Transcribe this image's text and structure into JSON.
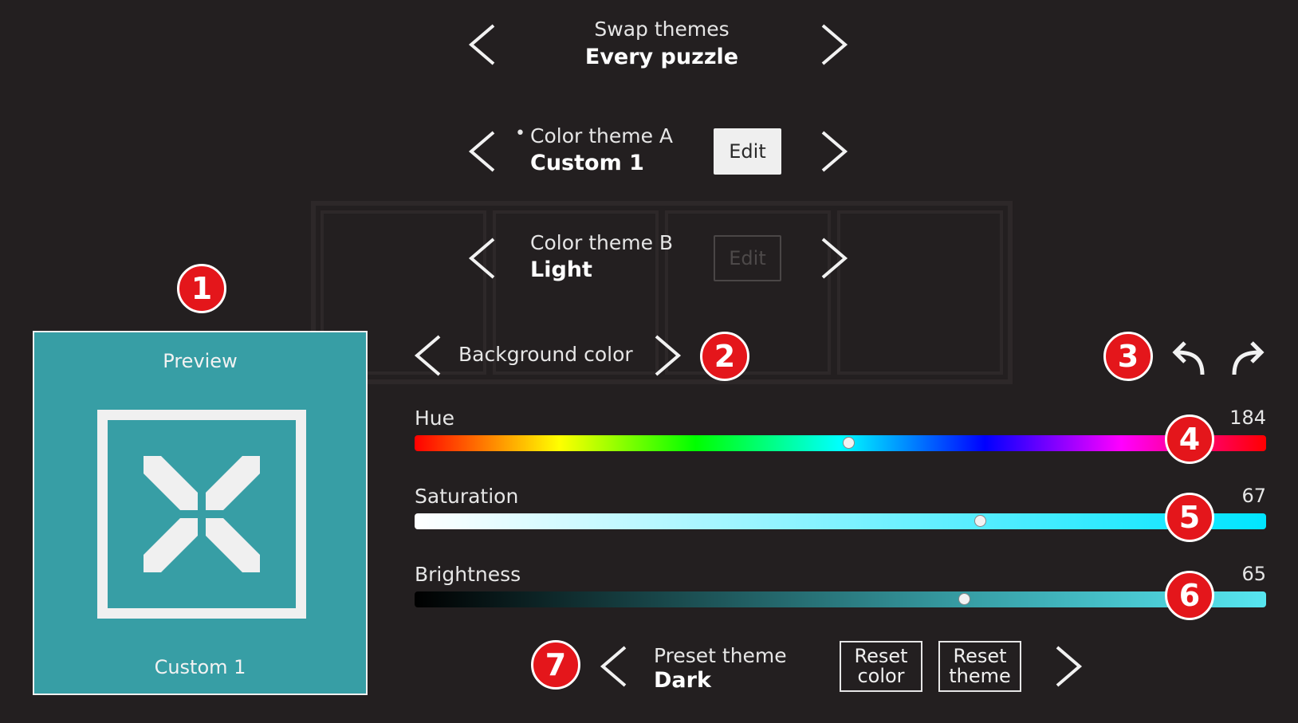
{
  "swap": {
    "label": "Swap themes",
    "value": "Every puzzle"
  },
  "theme_a": {
    "bullet": "•",
    "label": "Color theme A",
    "value": "Custom 1",
    "edit_label": "Edit"
  },
  "theme_b": {
    "label": "Color theme B",
    "value": "Light",
    "edit_label": "Edit"
  },
  "preview": {
    "title": "Preview",
    "theme_name": "Custom 1",
    "bg_color": "#379ea5"
  },
  "color_target": {
    "label": "Background color"
  },
  "sliders": {
    "hue": {
      "label": "Hue",
      "value": "184"
    },
    "saturation": {
      "label": "Saturation",
      "value": "67"
    },
    "brightness": {
      "label": "Brightness",
      "value": "65"
    }
  },
  "preset": {
    "label": "Preset theme",
    "value": "Dark"
  },
  "reset_color": {
    "line1": "Reset",
    "line2": "color"
  },
  "reset_theme": {
    "line1": "Reset",
    "line2": "theme"
  },
  "badges": [
    "1",
    "2",
    "3",
    "4",
    "5",
    "6",
    "7"
  ],
  "icons": {
    "prev": "chevron-left-icon",
    "next": "chevron-right-icon",
    "undo": "undo-icon",
    "redo": "redo-icon"
  },
  "colors": {
    "background": "#231f20",
    "accent": "#379ea5",
    "badge": "#e4161b"
  }
}
